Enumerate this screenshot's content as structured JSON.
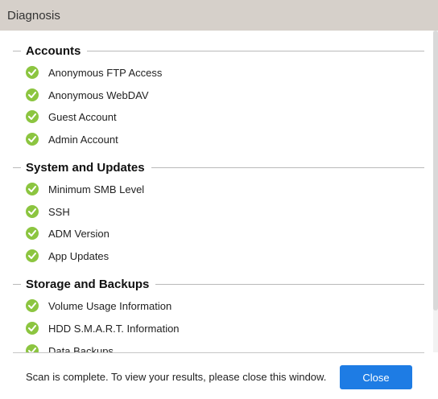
{
  "window": {
    "title": "Diagnosis"
  },
  "sections": [
    {
      "title": "Accounts",
      "items": [
        {
          "label": "Anonymous FTP Access",
          "status": "pass"
        },
        {
          "label": "Anonymous WebDAV",
          "status": "pass"
        },
        {
          "label": "Guest Account",
          "status": "pass"
        },
        {
          "label": "Admin Account",
          "status": "pass"
        }
      ]
    },
    {
      "title": "System and Updates",
      "items": [
        {
          "label": "Minimum SMB Level",
          "status": "pass"
        },
        {
          "label": "SSH",
          "status": "pass"
        },
        {
          "label": "ADM Version",
          "status": "pass"
        },
        {
          "label": "App Updates",
          "status": "pass"
        }
      ]
    },
    {
      "title": "Storage and Backups",
      "items": [
        {
          "label": "Volume Usage Information",
          "status": "pass"
        },
        {
          "label": "HDD S.M.A.R.T. Information",
          "status": "pass"
        },
        {
          "label": "Data Backups",
          "status": "pass"
        }
      ]
    }
  ],
  "footer": {
    "message": "Scan is complete. To view your results, please close this window.",
    "close_label": "Close"
  },
  "colors": {
    "pass": "#8cc540",
    "primary_button": "#1e7ce4",
    "titlebar": "#d6d0ca"
  },
  "icons": {
    "pass": "check-circle-icon"
  }
}
